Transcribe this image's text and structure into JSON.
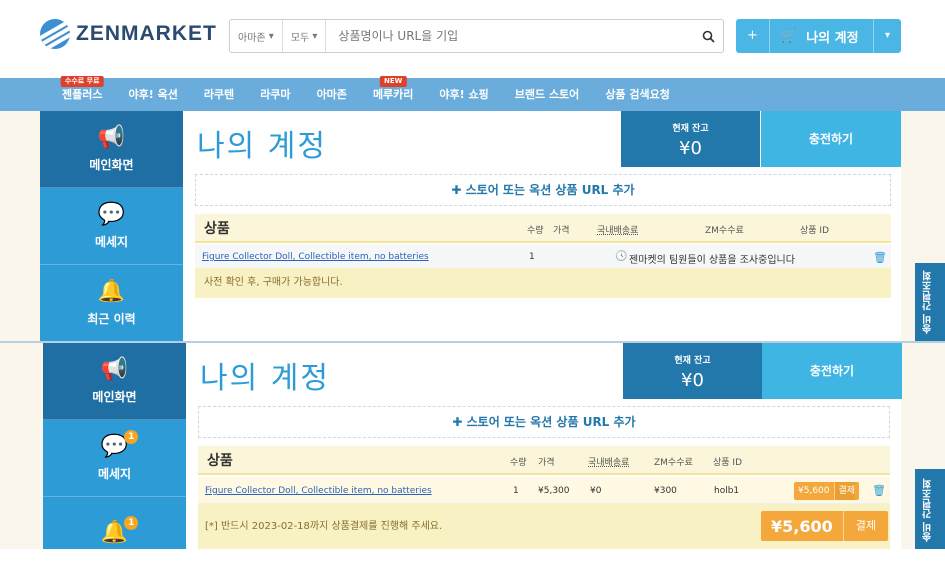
{
  "brand": {
    "name": "ZENMARKET"
  },
  "search": {
    "store_filter": "아마존",
    "scope_filter": "모두",
    "placeholder": "상품명이나 URL을 기입"
  },
  "account": {
    "plus": "+",
    "label": "나의 계정"
  },
  "nav": {
    "items": [
      {
        "label": "젠플러스",
        "badge": "수수료 무료"
      },
      {
        "label": "야후! 옥션",
        "badge": ""
      },
      {
        "label": "라쿠텐",
        "badge": ""
      },
      {
        "label": "라쿠마",
        "badge": ""
      },
      {
        "label": "아마존",
        "badge": ""
      },
      {
        "label": "메루카리",
        "badge": "NEW"
      },
      {
        "label": "야후! 쇼핑",
        "badge": ""
      },
      {
        "label": "브랜드 스토어",
        "badge": ""
      },
      {
        "label": "상품 검색요청",
        "badge": ""
      }
    ]
  },
  "panel1": {
    "sidebar": [
      {
        "label": "메인화면",
        "icon": "megaphone-icon",
        "badge": ""
      },
      {
        "label": "메세지",
        "icon": "speech-bubble-icon",
        "badge": ""
      },
      {
        "label": "최근 이력",
        "icon": "bell-icon",
        "badge": ""
      }
    ],
    "title": "나의 계정",
    "balance_caption": "현재 잔고",
    "balance_amount": "¥0",
    "charge_label": "충전하기",
    "add_url": "✚ 스토어 또는 옥션 상품 URL 추가",
    "table_title": "상품",
    "columns": [
      "수량",
      "가격",
      "국내배송료",
      "ZM수수료",
      "상품 ID"
    ],
    "row": {
      "name": "Figure Collector Doll, Collectible item, no batteries",
      "qty": "1",
      "status": "젠마켓의 팀원들이 상품을 조사중입니다"
    },
    "notice": "사전 확인 후, 구매가 가능합니다.",
    "side_tab": "송비 간편조회"
  },
  "panel2": {
    "sidebar": [
      {
        "label": "메인화면",
        "icon": "megaphone-icon",
        "badge": ""
      },
      {
        "label": "메세지",
        "icon": "speech-bubble-icon",
        "badge": "1"
      },
      {
        "label": "",
        "icon": "bell-icon",
        "badge": "1"
      }
    ],
    "title": "나의 계정",
    "balance_caption": "현재 잔고",
    "balance_amount": "¥0",
    "charge_label": "충전하기",
    "add_url": "✚ 스토어 또는 옥션 상품 URL 추가",
    "table_title": "상품",
    "columns": [
      "수량",
      "가격",
      "국내배송료",
      "ZM수수료",
      "상품 ID"
    ],
    "row": {
      "name": "Figure Collector Doll, Collectible item, no batteries",
      "qty": "1",
      "price": "¥5,300",
      "domestic_shipping": "¥0",
      "zm_fee": "¥300",
      "product_id": "holb1",
      "pay_amount": "¥5,600",
      "pay_label": "결제"
    },
    "notice": "[*] 반드시 2023-02-18까지 상품결제를 진행해 주세요.",
    "total_amount": "¥5,600",
    "total_pay_label": "결제",
    "side_tab": "송비 간편조회"
  }
}
